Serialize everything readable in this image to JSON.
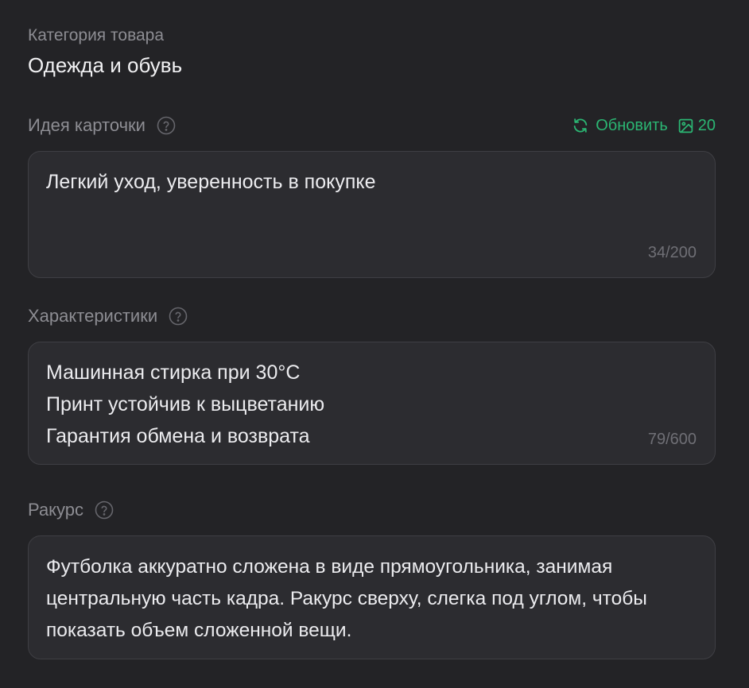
{
  "category": {
    "label": "Категория товара",
    "value": "Одежда и обувь"
  },
  "idea": {
    "label": "Идея карточки",
    "help_icon": "question-circle-icon",
    "refresh_label": "Обновить",
    "refresh_icon": "refresh-icon",
    "images_icon": "image-icon",
    "images_count": "20",
    "value": "Легкий уход, уверенность в покупке",
    "counter": "34/200"
  },
  "features": {
    "label": "Характеристики",
    "help_icon": "question-circle-icon",
    "value": "Машинная стирка при 30°C\nПринт устойчив к выцветанию\nГарантия обмена и возврата",
    "counter": "79/600"
  },
  "angle": {
    "label": "Ракурс",
    "help_icon": "question-circle-icon",
    "value": "Футболка аккуратно сложена в виде прямоугольника, занимая центральную часть кадра. Ракурс сверху, слегка под углом, чтобы показать объем сложенной вещи."
  },
  "colors": {
    "background": "#232326",
    "field_bg": "#2c2c30",
    "field_border": "#3f3f44",
    "label": "#8d8d93",
    "accent": "#2bb673",
    "counter": "#6f6f75"
  }
}
